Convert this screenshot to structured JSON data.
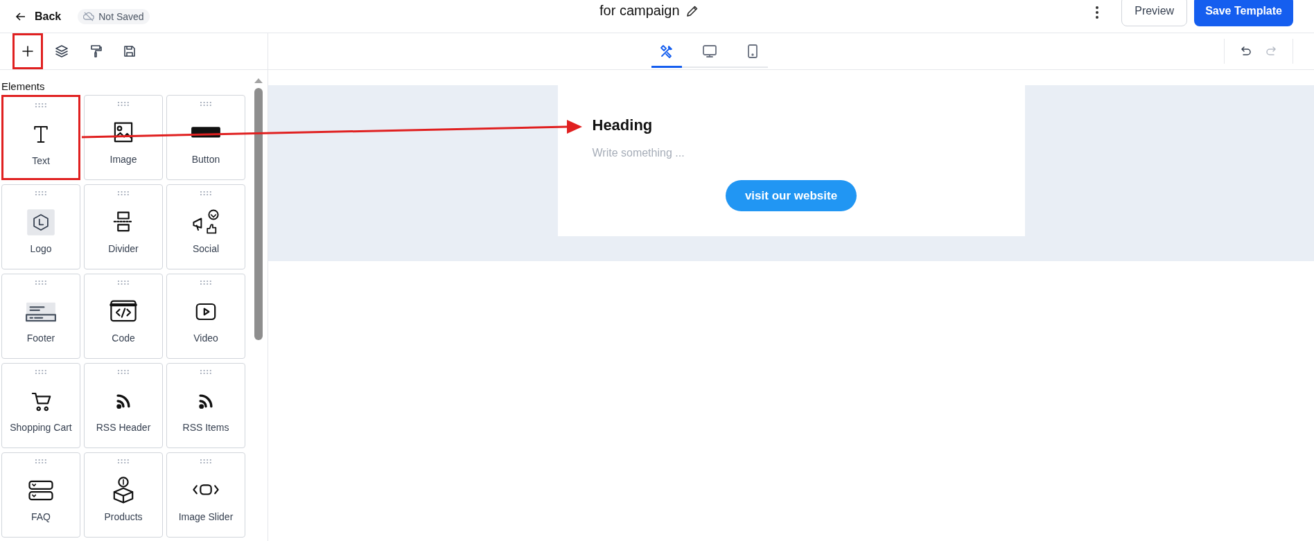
{
  "header": {
    "back": "Back",
    "save_status": "Not Saved",
    "title": "for campaign",
    "preview": "Preview",
    "save": "Save Template"
  },
  "tools": [
    {
      "highlighted": true
    },
    {
      "highlighted": false
    },
    {
      "highlighted": false
    },
    {
      "highlighted": false
    }
  ],
  "device_tabs": [
    {
      "selected": true
    },
    {
      "selected": false
    },
    {
      "selected": false
    }
  ],
  "history": {
    "undo_disabled": false,
    "redo_disabled": true
  },
  "sidebar": {
    "title": "Elements",
    "elements": [
      {
        "label": "Text",
        "highlighted": true
      },
      {
        "label": "Image",
        "highlighted": false
      },
      {
        "label": "Button",
        "highlighted": false
      },
      {
        "label": "Logo",
        "highlighted": false
      },
      {
        "label": "Divider",
        "highlighted": false
      },
      {
        "label": "Social",
        "highlighted": false
      },
      {
        "label": "Footer",
        "highlighted": false
      },
      {
        "label": "Code",
        "highlighted": false
      },
      {
        "label": "Video",
        "highlighted": false
      },
      {
        "label": "Shopping Cart",
        "highlighted": false
      },
      {
        "label": "RSS Header",
        "highlighted": false
      },
      {
        "label": "RSS Items",
        "highlighted": false
      },
      {
        "label": "FAQ",
        "highlighted": false
      },
      {
        "label": "Products",
        "highlighted": false
      },
      {
        "label": "Image Slider",
        "highlighted": false
      }
    ]
  },
  "canvas": {
    "heading": "Heading",
    "text_placeholder": "Write something ...",
    "button": "visit our website"
  }
}
